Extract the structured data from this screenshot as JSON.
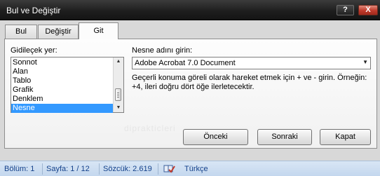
{
  "window": {
    "title": "Bul ve Değiştir",
    "help_label": "?",
    "close_label": "X"
  },
  "tabs": [
    {
      "label": "Bul"
    },
    {
      "label": "Değiştir"
    },
    {
      "label": "Git"
    }
  ],
  "goto": {
    "list_label": "Gidileçek yer:",
    "items": [
      "Sonnot",
      "Alan",
      "Tablo",
      "Grafik",
      "Denklem",
      "Nesne"
    ],
    "selected_item": "Nesne",
    "name_label": "Nesne adını girin:",
    "name_value": "Adobe Acrobat 7.0 Document",
    "hint": "Geçerli konuma göreli olarak hareket etmek için + ve - girin. Örneğin: +4, ileri doğru dört öğe ilerletecektir."
  },
  "buttons": {
    "previous": "Önceki",
    "next": "Sonraki",
    "close": "Kapat"
  },
  "watermark": "diprakticleri",
  "statusbar": {
    "page": "Bölüm: 1",
    "section": "Sayfa: 1 / 12",
    "words": "Sözcük: 2.619",
    "language": "Türkçe"
  },
  "icons": {
    "proofing": "book-check-icon",
    "scroll_up": "arrow-up-icon",
    "scroll_down": "arrow-down-icon",
    "dropdown": "dropdown-arrow-icon"
  },
  "colors": {
    "selection": "#3399ff",
    "statusbar_text": "#15428b",
    "close_button": "#c0392b"
  }
}
